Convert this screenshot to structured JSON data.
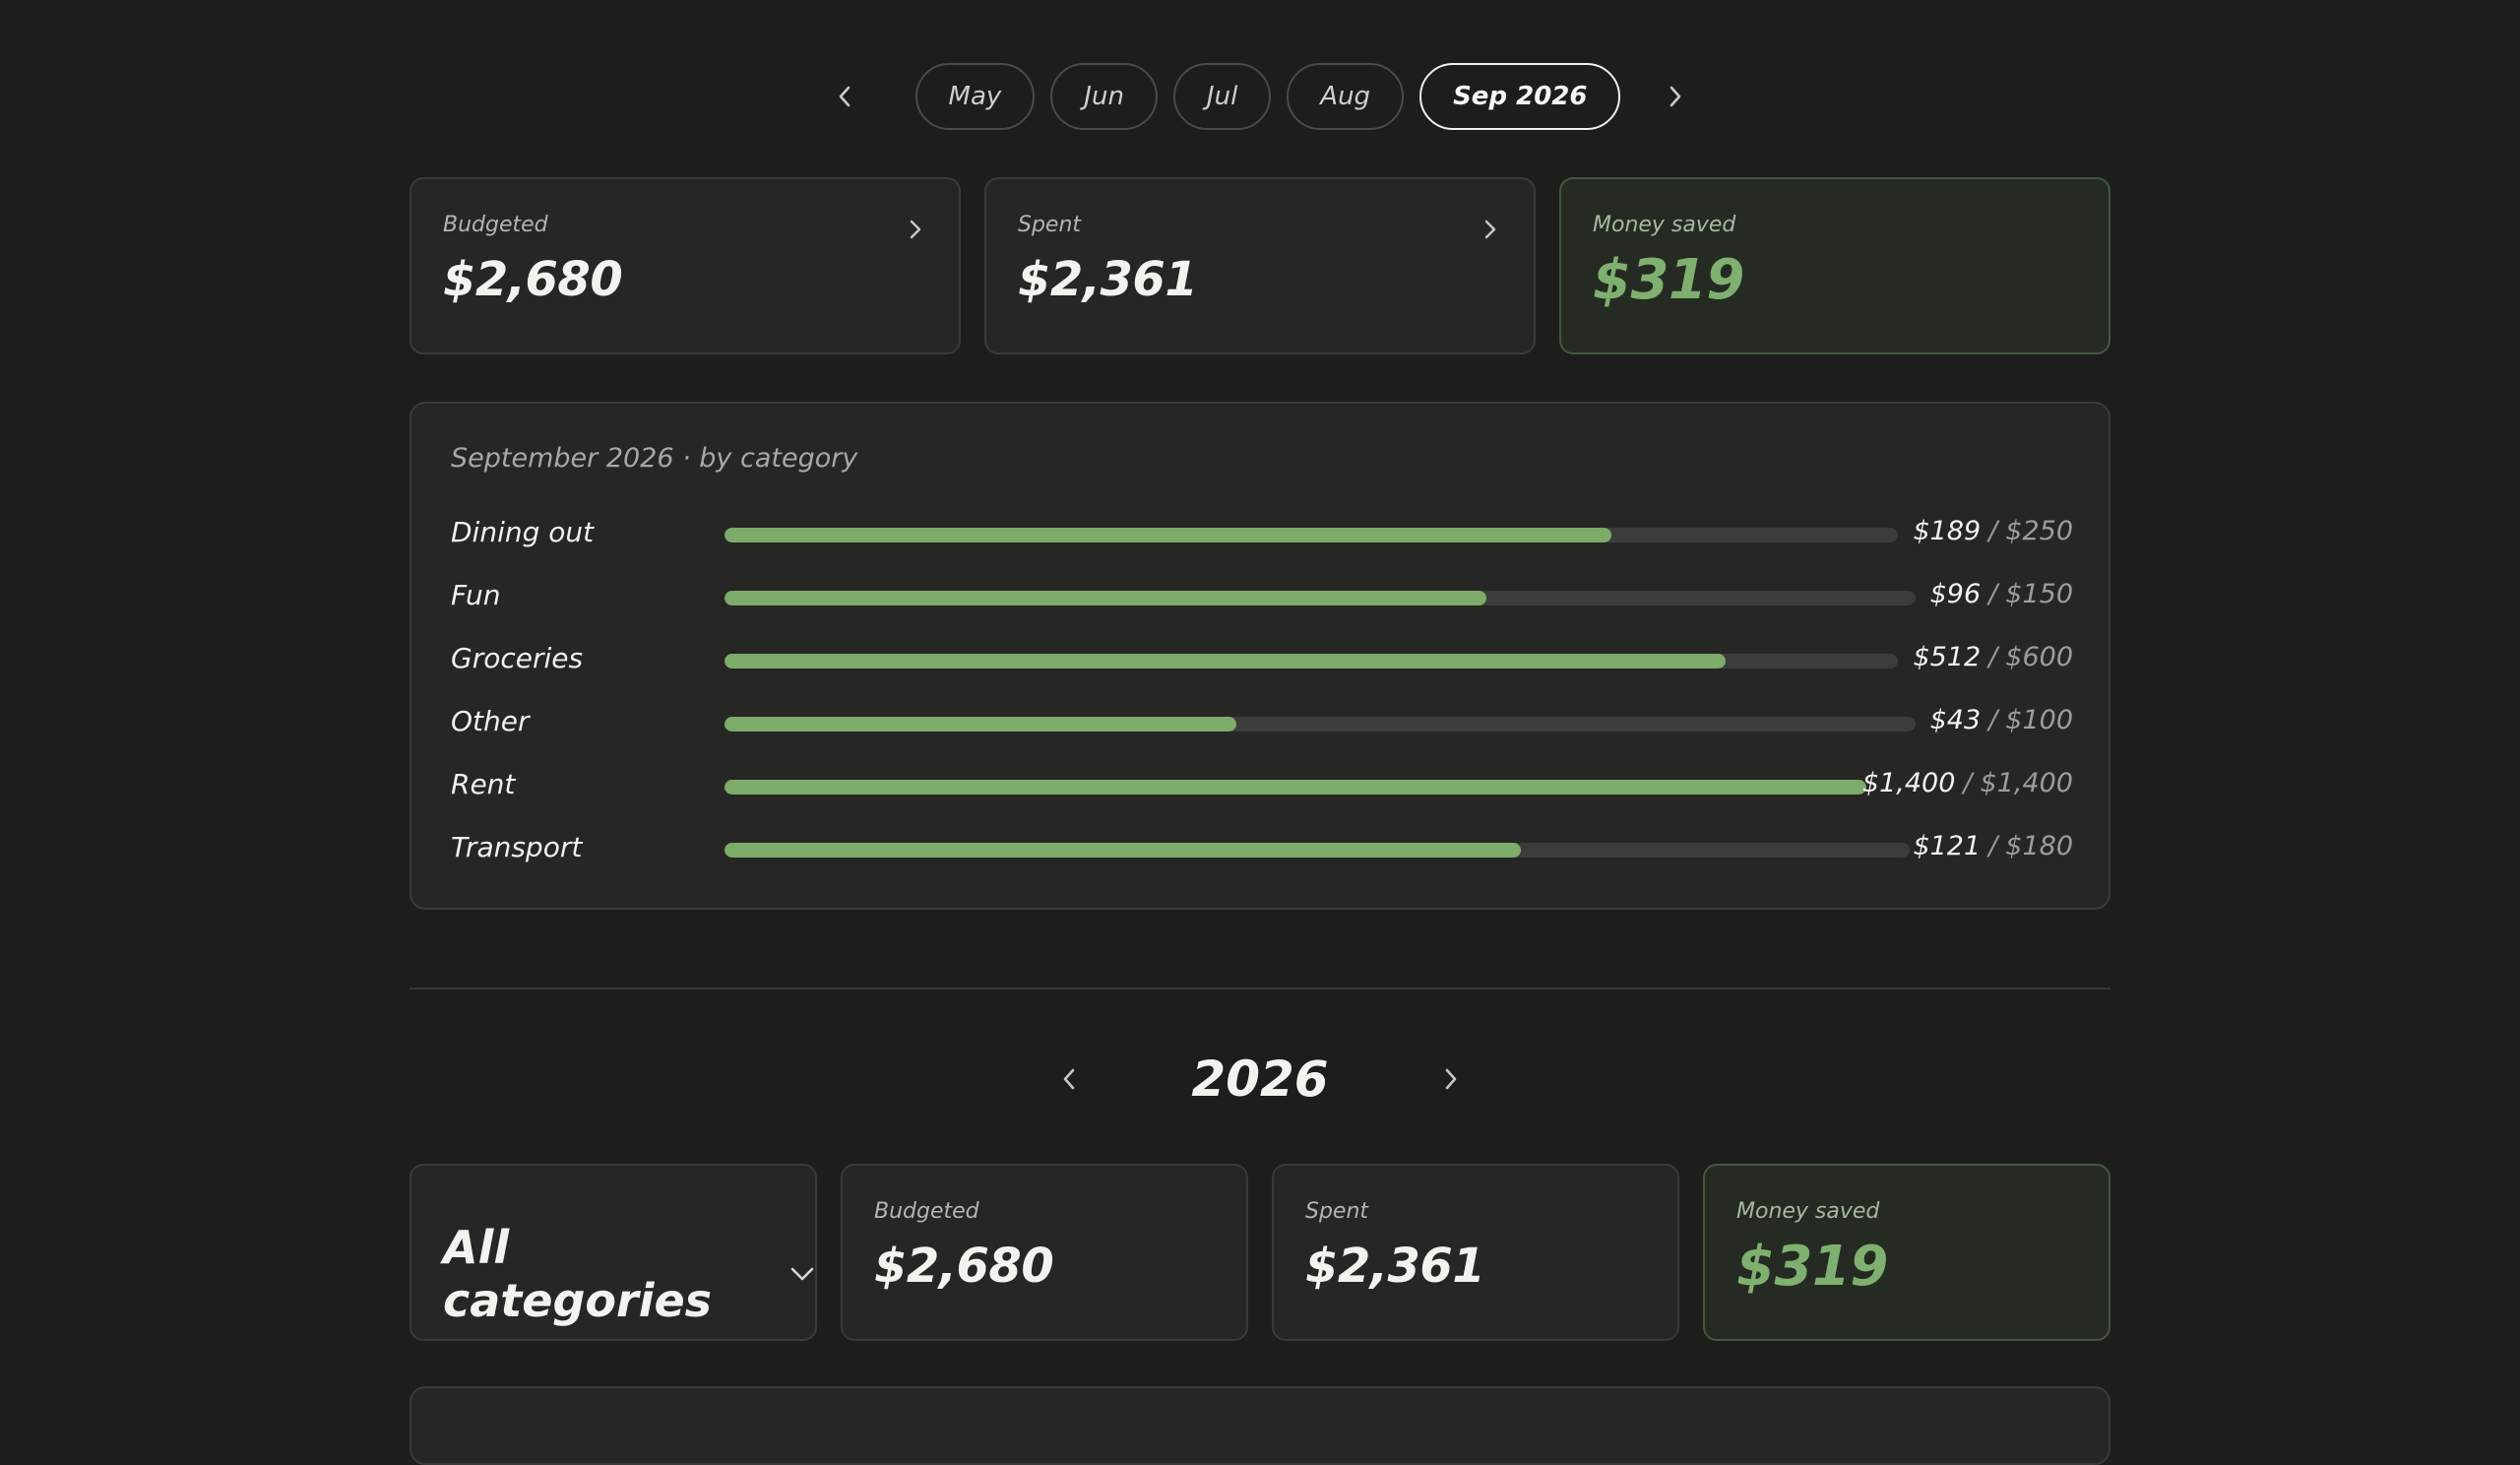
{
  "month_nav": {
    "months": [
      "May",
      "Jun",
      "Jul",
      "Aug"
    ],
    "active_month": "Sep 2026"
  },
  "summary": {
    "budgeted_label": "Budgeted",
    "budgeted_value": "$2,680",
    "spent_label": "Spent",
    "spent_value": "$2,361",
    "saved_label": "Money saved",
    "saved_value": "$319"
  },
  "categories_panel": {
    "title": "September 2026 · by category",
    "rows": [
      {
        "name": "Dining out",
        "spent": "$189",
        "budget": "$250",
        "ratio": 0.756
      },
      {
        "name": "Fun",
        "spent": "$96",
        "budget": "$150",
        "ratio": 0.64
      },
      {
        "name": "Groceries",
        "spent": "$512",
        "budget": "$600",
        "ratio": 0.853
      },
      {
        "name": "Other",
        "spent": "$43",
        "budget": "$100",
        "ratio": 0.43
      },
      {
        "name": "Rent",
        "spent": "$1,400",
        "budget": "$1,400",
        "ratio": 1.0
      },
      {
        "name": "Transport",
        "spent": "$121",
        "budget": "$180",
        "ratio": 0.672
      }
    ],
    "separator": "/"
  },
  "year_nav": {
    "year": "2026"
  },
  "year_summary": {
    "category_select": "All categories",
    "budgeted_label": "Budgeted",
    "budgeted_value": "$2,680",
    "spent_label": "Spent",
    "spent_value": "$2,361",
    "saved_label": "Money saved",
    "saved_value": "$319"
  },
  "colors": {
    "background": "#1d1d1c",
    "card": "#262625",
    "accent_green": "#7cab6a",
    "track": "#3c3c3a"
  }
}
